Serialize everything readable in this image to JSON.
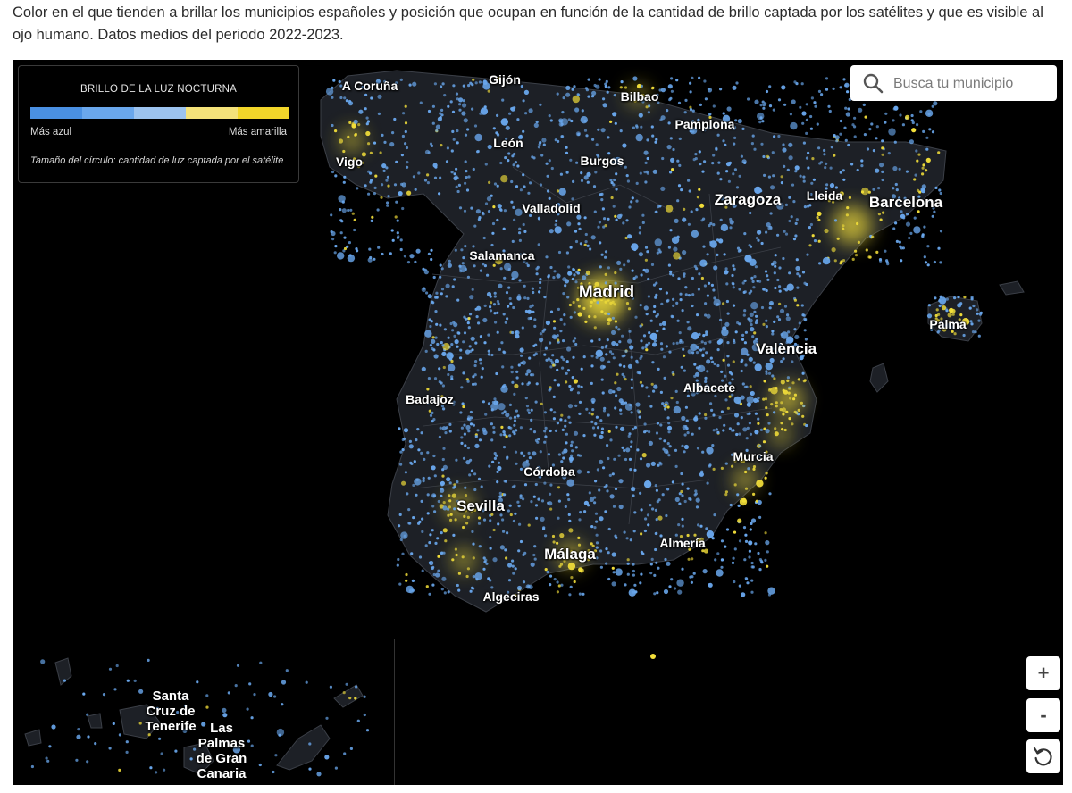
{
  "caption": "Color en el que tienden a brillar los municipios españoles y posición que ocupan en función de la cantidad de brillo captada por los satélites y que es visible al ojo humano. Datos medios del periodo 2022-2023.",
  "legend": {
    "title": "BRILLO DE LA LUZ NOCTURNA",
    "scale_colors": [
      "#4a90e2",
      "#6aa7ec",
      "#9cc3ef",
      "#f4e27a",
      "#f2d62a"
    ],
    "low_label": "Más azul",
    "high_label": "Más amarilla",
    "size_note": "Tamaño del círculo: cantidad de luz captada por el satélite"
  },
  "search": {
    "placeholder": "Busca tu municipio",
    "icon": "search-icon"
  },
  "controls": {
    "zoom_in": "+",
    "zoom_out": "-",
    "reset_icon": "reset-icon"
  },
  "cities": {
    "a_coruna": "A Coruña",
    "gijon": "Gijón",
    "bilbao": "Bilbao",
    "pamplona": "Pamplona",
    "leon": "León",
    "burgos": "Burgos",
    "vigo": "Vigo",
    "zaragoza": "Zaragoza",
    "lleida": "Lleida",
    "barcelona": "Barcelona",
    "valladolid": "Valladolid",
    "salamanca": "Salamanca",
    "madrid": "Madrid",
    "palma": "Palma",
    "valencia": "València",
    "badajoz": "Badajoz",
    "albacete": "Albacete",
    "murcia": "Murcia",
    "cordoba": "Córdoba",
    "sevilla": "Sevilla",
    "almeria": "Almería",
    "malaga": "Málaga",
    "algeciras": "Algeciras",
    "santa_cruz": "Santa Cruz de Tenerife",
    "las_palmas": "Las Palmas de Gran Canaria"
  },
  "colors": {
    "blue": "#6aa8ee",
    "yellow": "#f3df3a",
    "land": "#1d2026",
    "border": "#3b3f47"
  }
}
